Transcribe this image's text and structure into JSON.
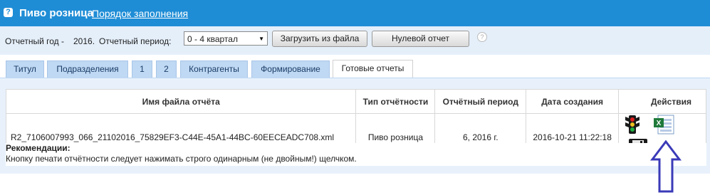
{
  "header": {
    "icon": "question-icon",
    "title": "Пиво розница",
    "link": "Порядок заполнения"
  },
  "toolbar": {
    "year_label": "Отчетный год -",
    "year_value": "2016.",
    "period_label": "Отчетный период:",
    "period_selected": "0 - 4 квартал",
    "load_button": "Загрузить из файла",
    "zero_button": "Нулевой отчет",
    "help_icon": "?"
  },
  "tabs": [
    "Титул",
    "Подразделения",
    "1",
    "2",
    "Контрагенты",
    "Формирование",
    "Готовые отчеты"
  ],
  "active_tab": "Готовые отчеты",
  "table": {
    "headers": [
      "Имя файла отчёта",
      "Тип отчётности",
      "Отчётный период",
      "Дата создания",
      "Действия"
    ],
    "rows": [
      {
        "file": "R2_7106007993_066_21102016_75829EF3-C44E-45A1-44BC-60EECEADC708.xml",
        "type": "Пиво розница",
        "period": "6, 2016 г.",
        "created": "2016-10-21 11:22:18",
        "actions": [
          "traffic-light-icon",
          "excel-icon",
          "floppy-save-icon"
        ]
      }
    ]
  },
  "notes": {
    "heading": "Рекомендации:",
    "text": "Кнопку печати отчётности следует нажимать строго одинарным (не двойным!) щелчком."
  },
  "colors": {
    "titlebar": "#1f8dd6",
    "toolbar_bg": "#e5effa",
    "tab_bg": "#bfd8f3",
    "annotation_arrow": "#3a3ab8"
  }
}
